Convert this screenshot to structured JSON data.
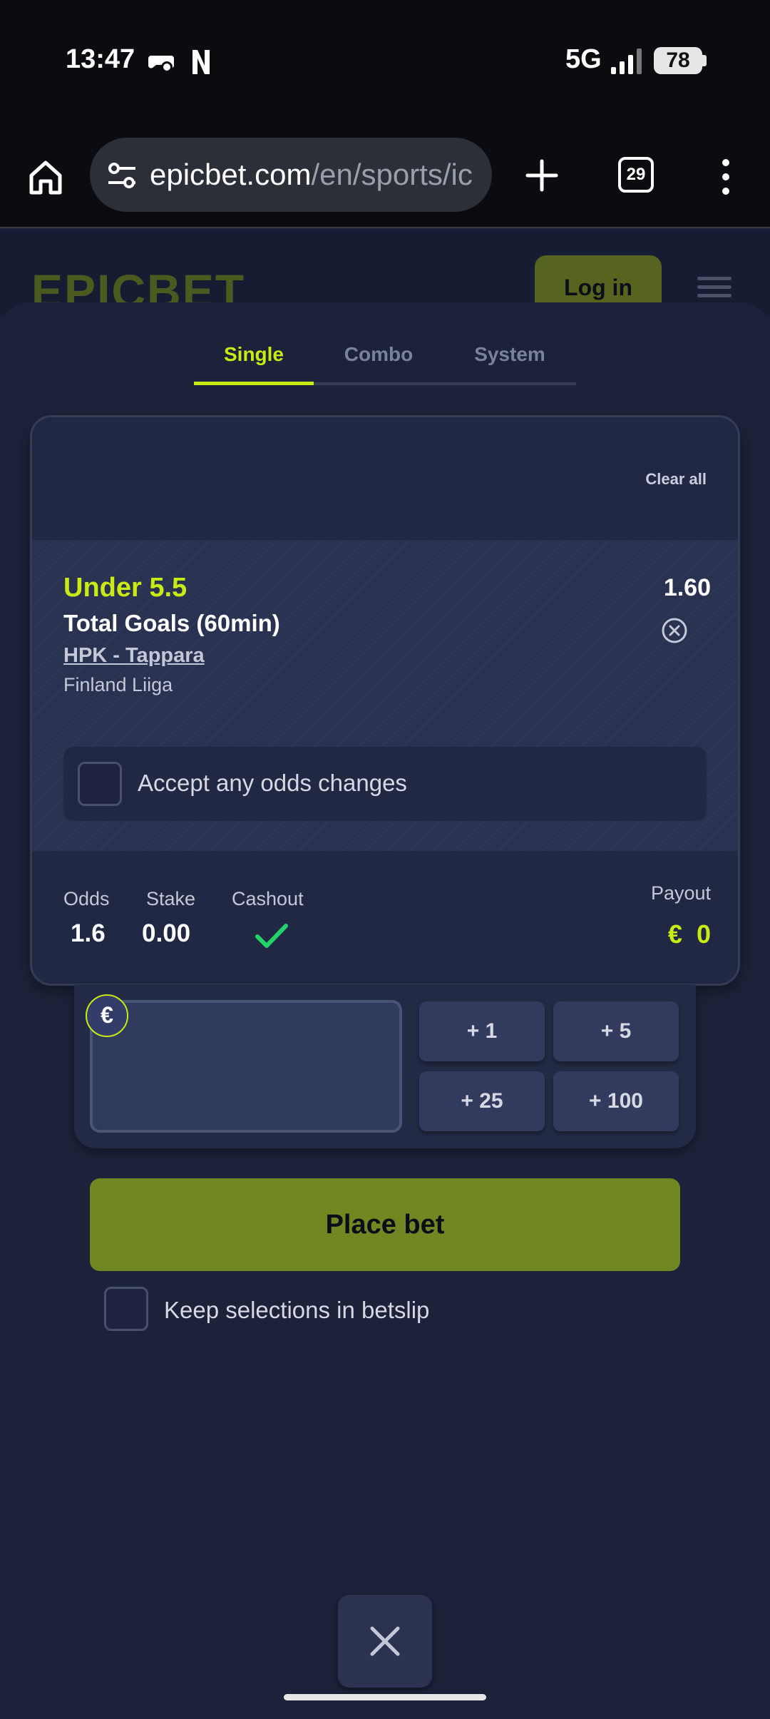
{
  "status_bar": {
    "time": "13:47",
    "network": "5G",
    "battery": "78"
  },
  "browser": {
    "url_domain": "epicbet.com",
    "url_path": "/en/sports/ic",
    "tab_count": "29"
  },
  "site": {
    "logo": "EPICBET",
    "login_label": "Log in"
  },
  "betslip": {
    "tabs": [
      {
        "label": "Single",
        "active": true
      },
      {
        "label": "Combo",
        "active": false
      },
      {
        "label": "System",
        "active": false
      }
    ],
    "clear_all": "Clear all",
    "selection": {
      "name": "Under 5.5",
      "market": "Total Goals (60min)",
      "event": "HPK - Tappara",
      "league": "Finland Liiga",
      "odds": "1.60"
    },
    "accept_odds_label": "Accept any odds changes",
    "summary": {
      "odds_label": "Odds",
      "odds_value": "1.6",
      "stake_label": "Stake",
      "stake_value": "0.00",
      "cashout_label": "Cashout",
      "payout_label": "Payout",
      "payout_currency": "€",
      "payout_value": "0"
    },
    "currency_symbol": "€",
    "quick_stakes": [
      "+ 1",
      "+ 5",
      "+ 25",
      "+ 100"
    ],
    "place_bet_label": "Place bet",
    "keep_selections_label": "Keep selections in betslip"
  },
  "colors": {
    "accent": "#c9ea13",
    "place_bet_bg": "#718722",
    "background": "#1c2239",
    "cashout_check": "#22d36a"
  }
}
